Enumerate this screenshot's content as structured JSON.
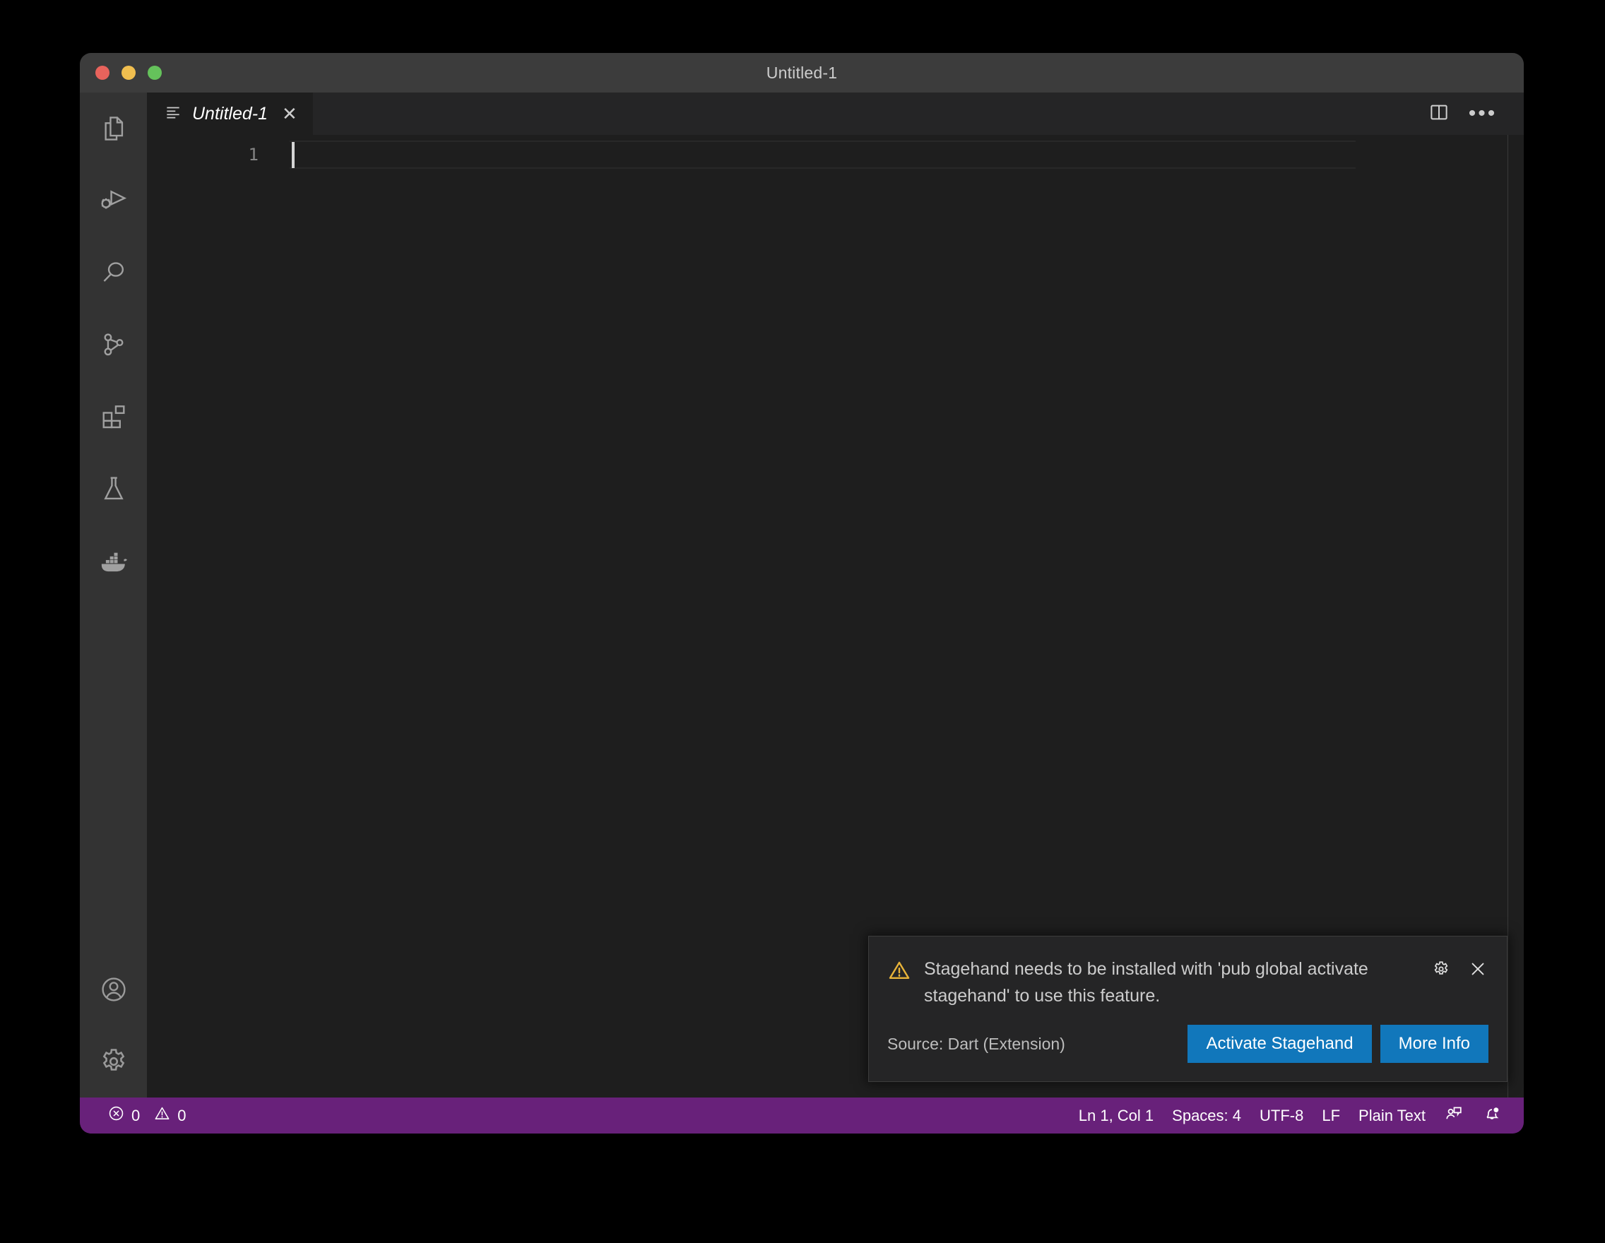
{
  "window": {
    "title": "Untitled-1",
    "traffic_lights": [
      "close-button",
      "minimize-button",
      "maximize-button"
    ]
  },
  "activity_bar": {
    "items": [
      {
        "name": "explorer",
        "icon": "files-icon",
        "label": "Explorer"
      },
      {
        "name": "run-debug",
        "icon": "run-and-debug-icon",
        "label": "Run and Debug"
      },
      {
        "name": "search",
        "icon": "search-icon",
        "label": "Search"
      },
      {
        "name": "source-control",
        "icon": "source-control-icon",
        "label": "Source Control"
      },
      {
        "name": "extensions",
        "icon": "extensions-icon",
        "label": "Extensions"
      },
      {
        "name": "testing",
        "icon": "beaker-icon",
        "label": "Testing"
      },
      {
        "name": "docker",
        "icon": "docker-whale-icon",
        "label": "Docker"
      }
    ],
    "bottom_items": [
      {
        "name": "accounts",
        "icon": "account-icon",
        "label": "Accounts"
      },
      {
        "name": "manage",
        "icon": "gear-icon",
        "label": "Manage"
      }
    ]
  },
  "tabs": [
    {
      "label": "Untitled-1",
      "icon": "text-file-icon",
      "close_label": "✕",
      "active": true,
      "dirty": false
    }
  ],
  "editor_actions": {
    "split_editor_label": "Split Editor",
    "more_actions_label": "•••"
  },
  "editor": {
    "line_numbers": [
      "1"
    ],
    "content": "",
    "cursor_line": 1,
    "cursor_column": 1
  },
  "notification": {
    "severity": "warning",
    "icon": "warning-triangle-icon",
    "message": "Stagehand needs to be installed with 'pub global activate stagehand' to use this feature.",
    "source": "Source: Dart (Extension)",
    "gear_label": "Configure Notification",
    "close_label": "Clear Notification",
    "actions": [
      {
        "label": "Activate Stagehand"
      },
      {
        "label": "More Info"
      }
    ]
  },
  "status_bar": {
    "left": [
      {
        "name": "problems",
        "icon": "error-icon",
        "errors": "0",
        "warn_icon": "warning-icon",
        "warnings": "0"
      }
    ],
    "right": [
      {
        "name": "cursor-position",
        "label": "Ln 1, Col 1"
      },
      {
        "name": "indentation",
        "label": "Spaces: 4"
      },
      {
        "name": "encoding",
        "label": "UTF-8"
      },
      {
        "name": "eol",
        "label": "LF"
      },
      {
        "name": "language-mode",
        "label": "Plain Text"
      },
      {
        "name": "feedback",
        "icon": "tweet-feedback-icon",
        "label": ""
      },
      {
        "name": "notifications",
        "icon": "bell-dot-icon",
        "label": ""
      }
    ]
  },
  "colors": {
    "titlebar_bg": "#3c3c3c",
    "activitybar_bg": "#333333",
    "editor_bg": "#1e1e1e",
    "tabbar_bg": "#252526",
    "statusbar_bg": "#68217a",
    "button_blue": "#1177bb",
    "warning_yellow": "#e8b339",
    "traffic_red": "#e8635c",
    "traffic_yellow": "#f0be4f",
    "traffic_green": "#65c25b"
  }
}
